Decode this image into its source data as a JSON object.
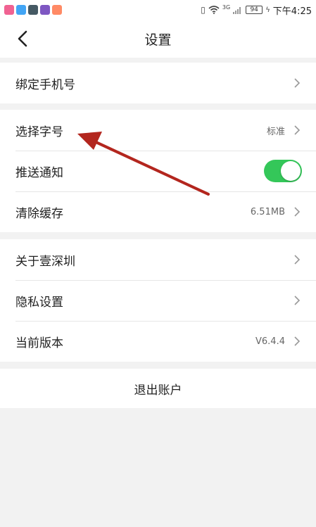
{
  "status_bar": {
    "app_icons": [
      {
        "icon": "pink-app-icon",
        "color": "#f06292"
      },
      {
        "icon": "blue-app-icon",
        "color": "#42a5f5"
      },
      {
        "icon": "dark-app-icon",
        "color": "#455a64"
      },
      {
        "icon": "purple-app-icon",
        "color": "#7e57c2"
      },
      {
        "icon": "orange-app-icon",
        "color": "#ff8a65"
      }
    ],
    "network": "3G",
    "battery": "94",
    "time": "下午4:25"
  },
  "nav": {
    "title": "设置",
    "back_icon": "chevron-left-icon"
  },
  "groups": [
    {
      "rows": [
        {
          "label": "绑定手机号",
          "value": "",
          "control": "chevron"
        }
      ]
    },
    {
      "rows": [
        {
          "label": "选择字号",
          "value": "标准",
          "control": "chevron"
        },
        {
          "label": "推送通知",
          "value": "",
          "control": "toggle",
          "toggle_on": true
        },
        {
          "label": "清除缓存",
          "value": "6.51MB",
          "control": "chevron"
        }
      ]
    },
    {
      "rows": [
        {
          "label": "关于壹深圳",
          "value": "",
          "control": "chevron"
        },
        {
          "label": "隐私设置",
          "value": "",
          "control": "chevron"
        },
        {
          "label": "当前版本",
          "value": "V6.4.4",
          "control": "chevron"
        }
      ]
    }
  ],
  "logout": {
    "label": "退出账户"
  },
  "colors": {
    "toggle_on": "#34c759",
    "annotation_arrow": "#b3261e",
    "background": "#f2f2f2"
  }
}
